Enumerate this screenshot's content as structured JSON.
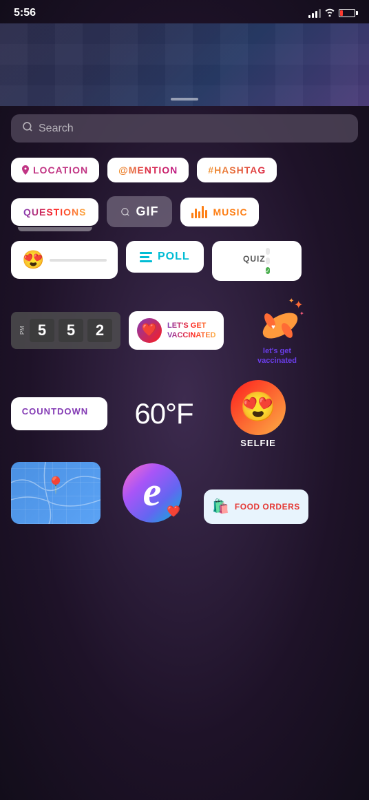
{
  "statusBar": {
    "time": "5:56",
    "batteryColor": "#ff3b30"
  },
  "search": {
    "placeholder": "Search"
  },
  "stickers": {
    "row1": {
      "location": "LOCATION",
      "mention": "@MENTION",
      "hashtag": "#HASHTAG"
    },
    "row2": {
      "questions": "QUESTIONS",
      "gif": "GIF",
      "music": "MUSIC"
    },
    "row3": {
      "poll": "POLL",
      "quiz": "QUIZ"
    },
    "row4": {
      "timeDigits": [
        "5",
        "5",
        "2"
      ],
      "timeLabel": "PM",
      "vaccinated": "LET'S GET\nVACCINATED",
      "getVaccLabel": "let's get\nvaccinated"
    },
    "row5": {
      "countdown": "COUNTDOWN",
      "temperature": "60°F",
      "selfie": "SELFIE"
    },
    "row6": {
      "foodOrders": "FOOD ORDERS"
    }
  },
  "icons": {
    "search": "🔍",
    "location": "📍",
    "searchSmall": "🔍",
    "musicBars": "▐▌▐▌▐",
    "heart": "❤️",
    "bandaid": "🩹",
    "sparkle": "✨",
    "mapPin": "📍",
    "foodBag": "🛍️"
  }
}
